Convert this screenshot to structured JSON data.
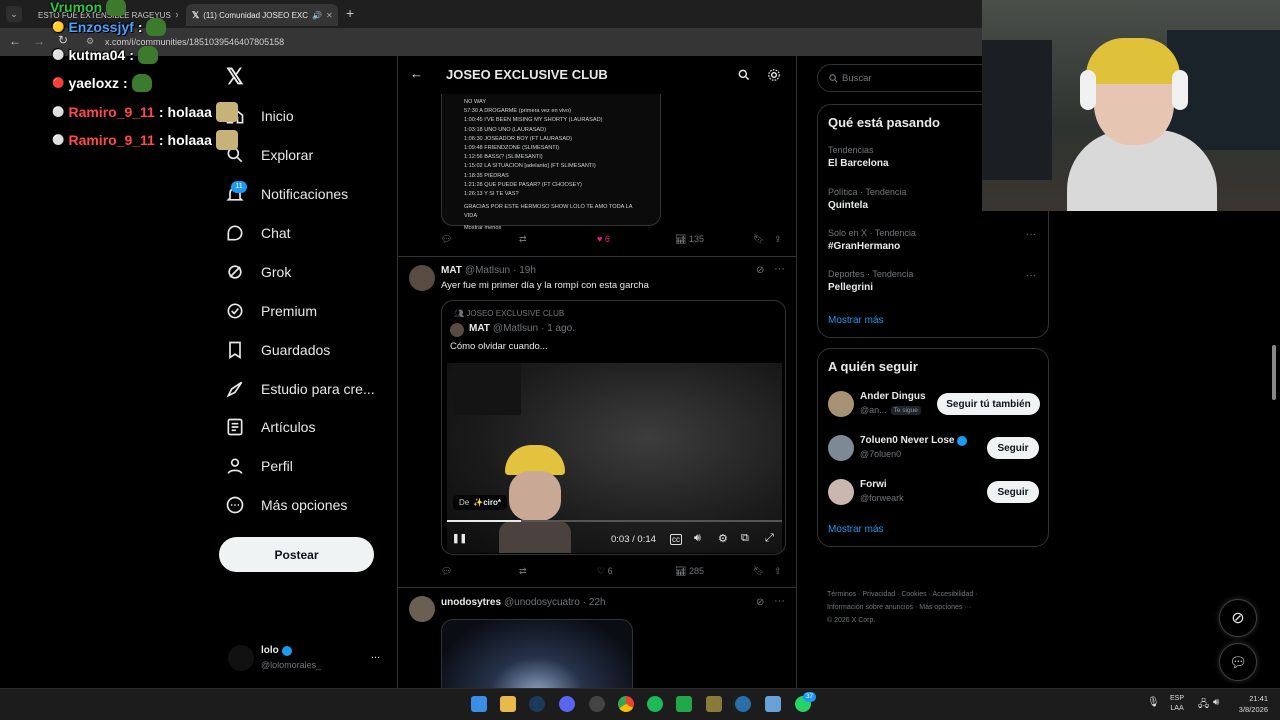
{
  "browser": {
    "tabs": [
      {
        "label": "ESTO FUE EXTENSIBLE RAGEYUS"
      },
      {
        "label": "(11) Comunidad JOSEO EXC"
      }
    ],
    "url": "x.com/i/communities/1851039546407805158",
    "new_tab": "+"
  },
  "sidebar": {
    "items": [
      {
        "label": "Inicio"
      },
      {
        "label": "Explorar"
      },
      {
        "label": "Notificaciones",
        "badge": "11"
      },
      {
        "label": "Chat"
      },
      {
        "label": "Grok"
      },
      {
        "label": "Premium"
      },
      {
        "label": "Guardados"
      },
      {
        "label": "Estudio para cre..."
      },
      {
        "label": "Artículos"
      },
      {
        "label": "Perfil"
      },
      {
        "label": "Más opciones"
      }
    ],
    "post_button": "Postear",
    "account": {
      "name": "lolo",
      "handle": "@lolomorales_",
      "more": "..."
    }
  },
  "main": {
    "title": "JOSEO EXCLUSIVE CLUB",
    "tracklist": [
      "NO WAY",
      "57:30 A DROGARME (primera vez en vivo)",
      "1:00:45 I'VE BEEN MISING MY SHORTY (LAURASAD)",
      "1:03:18 UNO UNO (LAURASAD)",
      "1:06:30 JOSEADOR BOY (FT LAURASAD)",
      "1:09:48 FRIENDZONE (SLIMESANTI)",
      "1:12:56 BASS(? (SLIMESANTI)",
      "1:15:02 LA SITUACION [adelanto] (FT SLIMESANTI)",
      "1:18:35 PIEDRAS",
      "1:21:28 QUE PUEDE PASAR? (FT CHOOSEY)",
      "1:26:13 Y SI TE VAS?",
      "GRACIAS POR ESTE HERMOSO SHOW LOLO TE AMO TODA LA VIDA"
    ],
    "show_less": "Mostrar menos",
    "post1_actions": {
      "likes": "6",
      "views": "135"
    },
    "post2": {
      "name": "MAT",
      "handle": "@Matlsun",
      "time": "· 19h",
      "text": "Ayer fue mi primer día y la rompí con esta garcha",
      "quote": {
        "community": "JOSEO EXCLUSIVE CLUB",
        "name": "MAT",
        "handle": "@Matlsun",
        "time": "· 1 ago.",
        "text": "Cómo olvidar cuando...",
        "from_prefix": "De",
        "from_name": "✨ciro*",
        "video_time": "0:03 / 0:14",
        "progress": 0.22
      },
      "actions": {
        "likes": "6",
        "views": "285"
      }
    },
    "post3": {
      "name": "unodosytres",
      "handle": "@unodosycuatro",
      "time": "· 22h"
    }
  },
  "right": {
    "search_placeholder": "Buscar",
    "trends_title": "Qué está pasando",
    "trends": [
      {
        "context": "Tendencias",
        "name": "El Barcelona"
      },
      {
        "context": "Política · Tendencia",
        "name": "Quintela"
      },
      {
        "context": "Solo en X · Tendencia",
        "name": "#GranHermano"
      },
      {
        "context": "Deportes · Tendencia",
        "name": "Pellegrini"
      }
    ],
    "trends_more": "Mostrar más",
    "follow_title": "A quién seguir",
    "follow": [
      {
        "name": "Ander Dingus",
        "handle": "@an...",
        "tag": "Te sigue",
        "button": "Seguir tú también"
      },
      {
        "name": "7oluen0 Never Lose",
        "handle": "@7oluen0",
        "button": "Seguir"
      },
      {
        "name": "Forwi",
        "handle": "@forweark",
        "button": "Seguir"
      }
    ],
    "follow_more": "Mostrar más",
    "footer": {
      "line1": [
        "Términos",
        "Privacidad",
        "Cookies",
        "Accesibilidad"
      ],
      "line2": [
        "Información sobre anuncios",
        "Más opciones ···"
      ],
      "copyright": "© 2026 X Corp."
    }
  },
  "chat_overlay": [
    {
      "user": "Vrumon",
      "msg": ""
    },
    {
      "user": "Enzossjyf",
      "msg": ""
    },
    {
      "user": "kutma04",
      "msg": ""
    },
    {
      "user": "yaeloxz",
      "msg": ""
    },
    {
      "user": "Ramiro_9_11",
      "msg": "holaaa"
    },
    {
      "user": "Ramiro_9_11",
      "msg": "holaaa"
    }
  ],
  "taskbar": {
    "lang": "ESP",
    "region": "LAA",
    "time": "21:41",
    "date": "3/8/2026",
    "badge": "37"
  },
  "colors": {
    "accent": "#1d9bf0",
    "like": "#f91880",
    "username_colors": [
      "#2ecc40",
      "#4aa3ff",
      "#ffffff",
      "#ff4a4a"
    ]
  }
}
